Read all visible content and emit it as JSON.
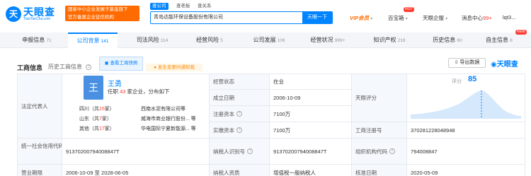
{
  "header": {
    "logo_char": "天",
    "brand": "天眼查",
    "brand_sub": "TianYanCha.com",
    "badge_lines": [
      "国家中小企业发展子基金旗下",
      "官方备案企业征信机构"
    ],
    "search_tabs": [
      "查公司",
      "查老板",
      "查关系"
    ],
    "search_value": "青岛达能环保设备股份有限公司",
    "search_button": "天眼一下",
    "vip_label": "VIP会员",
    "tools_label": "百宝箱",
    "tools_hot": "HOT",
    "enterprise_label": "天眼企服",
    "messages_label": "消息中心",
    "messages_count": "99+",
    "user_label": "lqt3..."
  },
  "tabs": [
    {
      "label": "申报信息",
      "count": "71"
    },
    {
      "label": "公司背景",
      "count": "141"
    },
    {
      "label": "司法风险",
      "count": "114"
    },
    {
      "label": "经营风险",
      "count": "5"
    },
    {
      "label": "公司发展",
      "count": "106"
    },
    {
      "label": "经营状况",
      "count": "999+"
    },
    {
      "label": "知识产权",
      "count": "218"
    },
    {
      "label": "历史信息",
      "count": "60"
    },
    {
      "label": "自主信息",
      "count": "8"
    }
  ],
  "tabs_new_badge": "NEW",
  "section": {
    "title": "工商信息",
    "history": "历史工商信息",
    "history_count": "2",
    "screenshot_btn": "查看工商快照",
    "risk_notice": "发生变更时通知我",
    "export_btn": "导出数据",
    "watermark": "天眼查"
  },
  "legal_rep": {
    "label": "法定代表人",
    "avatar_char": "王",
    "name": "王勇",
    "desc_prefix": "任职",
    "desc_count": "43",
    "desc_suffix": "家企业，分布如下",
    "regions": [
      {
        "region": "四川",
        "count": "15",
        "company": "西南水泥有限公司等"
      },
      {
        "region": "山东",
        "count": "7",
        "company": "威海市商业银行股份... 等"
      },
      {
        "region": "其他",
        "count": "17",
        "company": "华电国际宁夏新能源... 等"
      }
    ]
  },
  "fields": {
    "status_label": "经营状态",
    "status_value": "在业",
    "founded_label": "成立日期",
    "founded_value": "2006-10-09",
    "reg_capital_label": "注册资本",
    "reg_capital_value": "7100万",
    "paid_capital_label": "实缴资本",
    "paid_capital_value": "7100万",
    "score_label": "天眼评分",
    "score_small": "评分",
    "score_value": "85",
    "reg_no_label": "工商注册号",
    "reg_no_value": "370281228048948",
    "credit_code_label": "统一社会信用代码",
    "credit_code_value": "91370200794008847T",
    "taxpayer_id_label": "纳税人识别号",
    "taxpayer_id_value": "91370200794008847T",
    "org_code_label": "组织机构代码",
    "org_code_value": "794008847",
    "term_label": "营业期限",
    "term_value": "2006-10-09 至 2028-06-05",
    "taxpayer_type_label": "纳税人资质",
    "taxpayer_type_value": "增值税一般纳税人",
    "approval_label": "核准日期",
    "approval_value": "2020-05-09"
  },
  "colors": {
    "accent": "#0084ff",
    "vip": "#ff6b00",
    "badge": "#ff6b00",
    "hot": "#ff3b30"
  }
}
